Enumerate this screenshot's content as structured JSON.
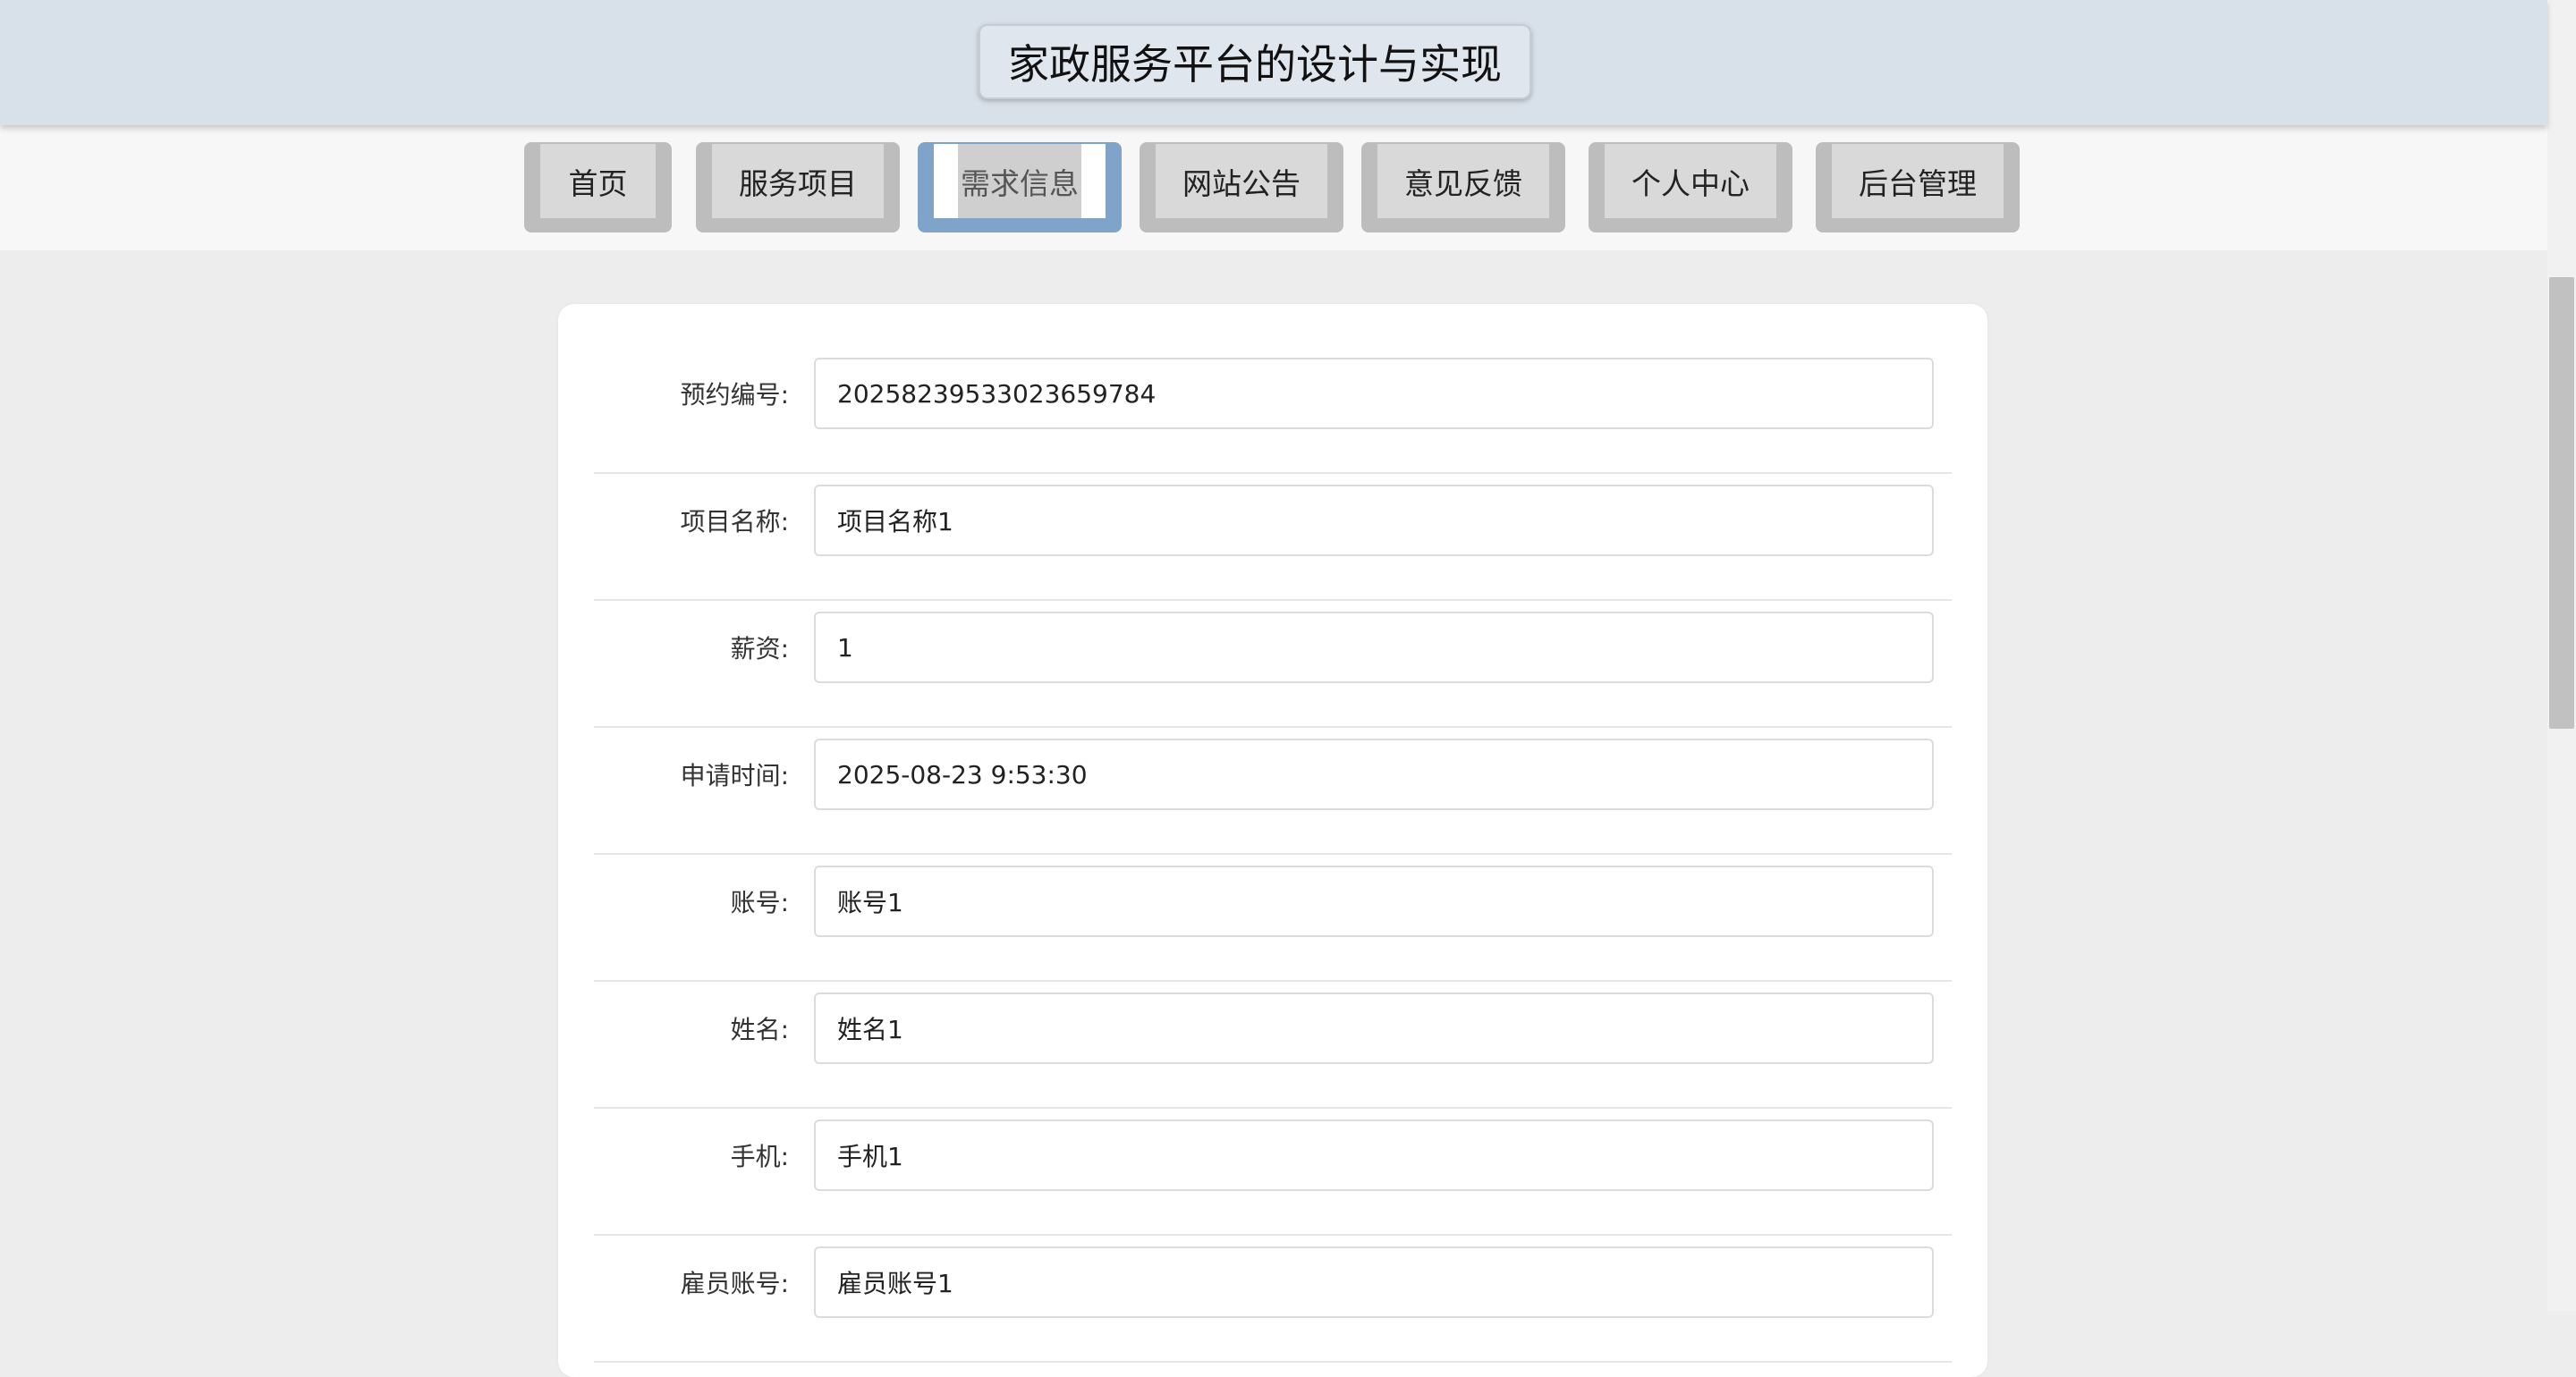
{
  "header": {
    "title": "家政服务平台的设计与实现"
  },
  "nav": {
    "items": [
      {
        "label": "首页"
      },
      {
        "label": "服务项目"
      },
      {
        "label": "需求信息"
      },
      {
        "label": "网站公告"
      },
      {
        "label": "意见反馈"
      },
      {
        "label": "个人中心"
      },
      {
        "label": "后台管理"
      }
    ],
    "active": "需求信息"
  },
  "form": {
    "rows": [
      {
        "label": "预约编号:",
        "value": "20258239533023659784"
      },
      {
        "label": "项目名称:",
        "value": "项目名称1"
      },
      {
        "label": "薪资:",
        "value": "1"
      },
      {
        "label": "申请时间:",
        "value": "2025-08-23 9:53:30"
      },
      {
        "label": "账号:",
        "value": "账号1"
      },
      {
        "label": "姓名:",
        "value": "姓名1"
      },
      {
        "label": "手机:",
        "value": "手机1"
      },
      {
        "label": "雇员账号:",
        "value": "雇员账号1"
      }
    ]
  },
  "colors": {
    "header_bg": "#d8e0e9",
    "active_tab": "#7fa3c9",
    "page_bg": "#ededed"
  }
}
